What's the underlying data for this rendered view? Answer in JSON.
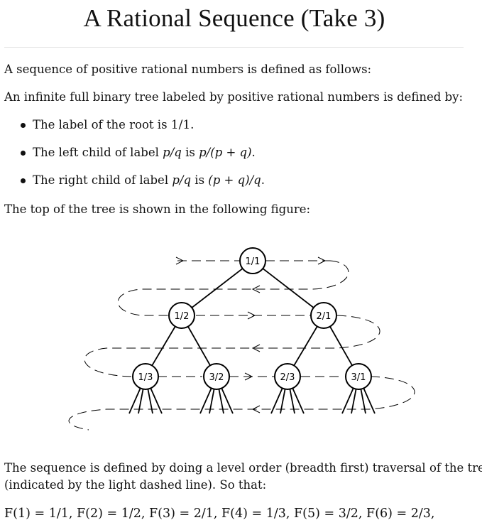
{
  "title": "A Rational Sequence (Take 3)",
  "intro": "A sequence of positive rational numbers is defined as follows:",
  "tree_intro": "An infinite full binary tree labeled by positive rational numbers is defined by:",
  "rules": [
    {
      "text": "The label of the root is ",
      "math": "1/1",
      "tail": "."
    },
    {
      "text": "The left child of label ",
      "math": "p/q",
      "mid": " is ",
      "math2": "p/(p + q)",
      "tail": "."
    },
    {
      "text": "The right child of label ",
      "math": "p/q",
      "mid": " is ",
      "math2": "(p + q)/q",
      "tail": "."
    }
  ],
  "figure_intro": "The top of the tree is shown in the following figure:",
  "tree": {
    "levels": [
      [
        "1/1"
      ],
      [
        "1/2",
        "2/1"
      ],
      [
        "1/3",
        "3/2",
        "2/3",
        "3/1"
      ]
    ]
  },
  "sequence_line1": "The sequence is defined by doing a level order (breadth first) traversal of the tree",
  "sequence_line2": "(indicated by the light dashed line). So that:",
  "formula": "F(1) = 1/1, F(2) = 1/2, F(3) = 2/1, F(4) = 1/3, F(5) = 3/2, F(6) = 2/3,"
}
